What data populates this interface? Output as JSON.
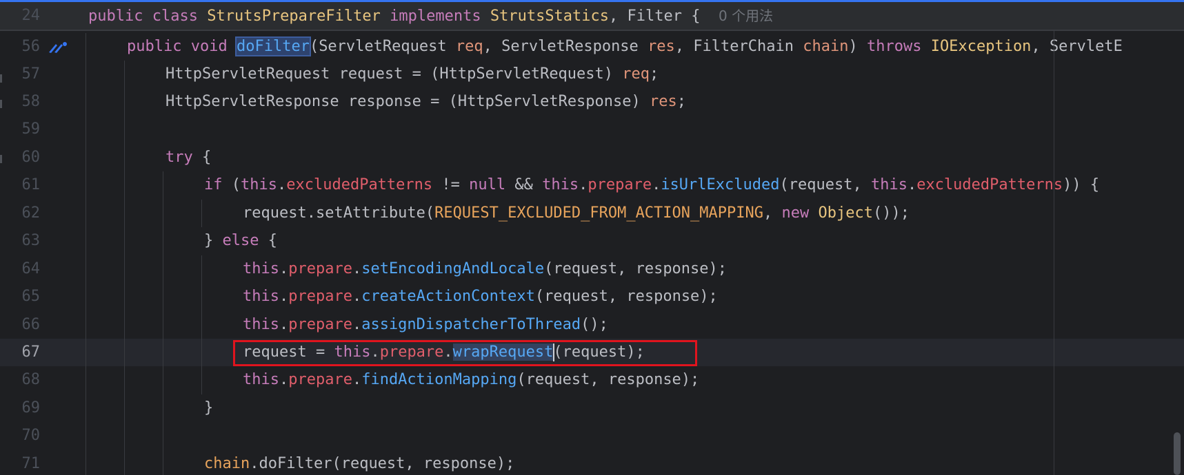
{
  "sticky_header": {
    "line_number": "24",
    "code": {
      "public": "public",
      "class": "class",
      "class_name": "StrutsPrepareFilter",
      "implements": "implements",
      "iface1": "StrutsStatics",
      "comma": ", ",
      "iface2": "Filter",
      "brace": " {"
    },
    "usage_hint": "0 个用法"
  },
  "lines": [
    {
      "n": "56"
    },
    {
      "n": "57"
    },
    {
      "n": "58"
    },
    {
      "n": "59"
    },
    {
      "n": "60"
    },
    {
      "n": "61"
    },
    {
      "n": "62"
    },
    {
      "n": "63"
    },
    {
      "n": "64"
    },
    {
      "n": "65"
    },
    {
      "n": "66"
    },
    {
      "n": "67"
    },
    {
      "n": "68"
    },
    {
      "n": "69"
    },
    {
      "n": "70"
    },
    {
      "n": "71"
    }
  ],
  "tokens": {
    "public": "public",
    "void": "void",
    "doFilter": "doFilter",
    "ServletRequest": "ServletRequest",
    "req": "req",
    "ServletResponse": "ServletResponse",
    "res": "res",
    "FilterChain": "FilterChain",
    "chain": "chain",
    "throws": "throws",
    "IOException": "IOException",
    "ServletE": "ServletE",
    "HttpServletRequest": "HttpServletRequest",
    "request": "request",
    "HttpServletResponse": "HttpServletResponse",
    "response": "response",
    "try": "try",
    "if": "if",
    "this": "this",
    "excludedPatterns": "excludedPatterns",
    "null": "null",
    "prepare": "prepare",
    "isUrlExcluded": "isUrlExcluded",
    "setAttribute": "setAttribute",
    "REQUEST_EXCLUDED": "REQUEST_EXCLUDED_FROM_ACTION_MAPPING",
    "new": "new",
    "Object": "Object",
    "else": "else",
    "setEncodingAndLocale": "setEncodingAndLocale",
    "createActionContext": "createActionContext",
    "assignDispatcherToThread": "assignDispatcherToThread",
    "wrapRequest": "wrapRequest",
    "findActionMapping": "findActionMapping",
    "doFilterCall": "doFilter"
  },
  "colors": {
    "background": "#1e1f22",
    "keyword": "#cf8e6d",
    "field": "#e05e6b",
    "method": "#56a8f5",
    "constant": "#e8a45c",
    "highlight_box": "#e0141e"
  }
}
